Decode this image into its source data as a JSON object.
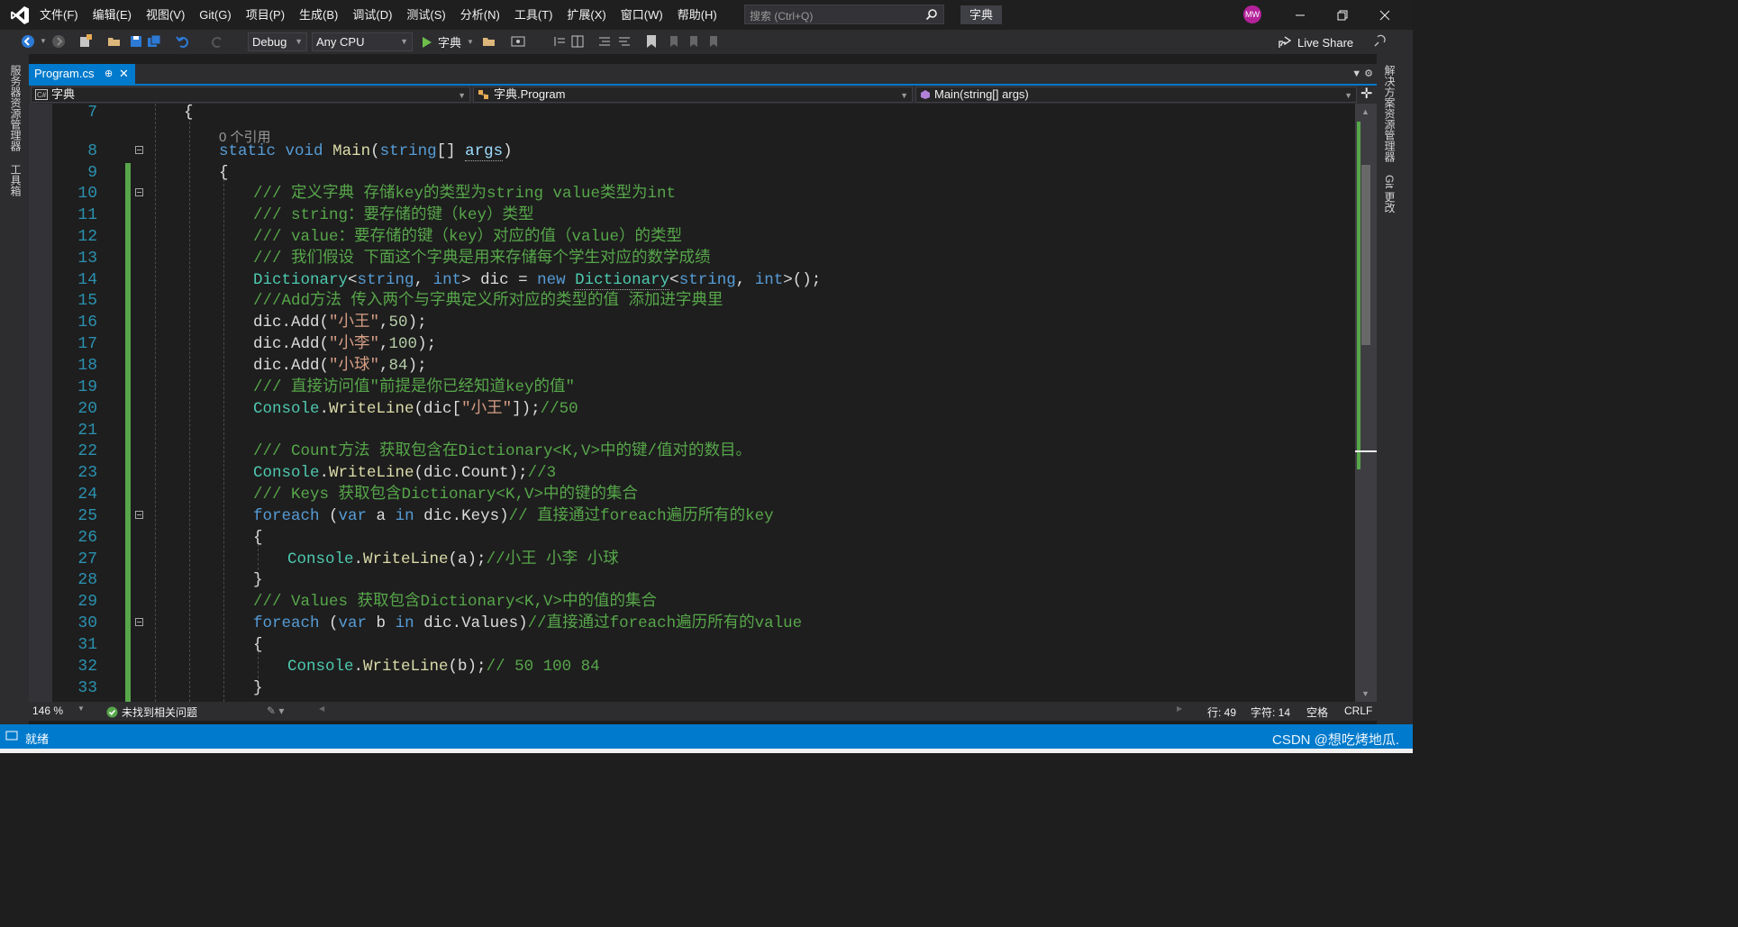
{
  "titlebar": {
    "logo_icon": "visual-studio-logo",
    "menu": [
      {
        "label": "文件(F)"
      },
      {
        "label": "编辑(E)"
      },
      {
        "label": "视图(V)"
      },
      {
        "label": "Git(G)"
      },
      {
        "label": "项目(P)"
      },
      {
        "label": "生成(B)"
      },
      {
        "label": "调试(D)"
      },
      {
        "label": "测试(S)"
      },
      {
        "label": "分析(N)"
      },
      {
        "label": "工具(T)"
      },
      {
        "label": "扩展(X)"
      },
      {
        "label": "窗口(W)"
      },
      {
        "label": "帮助(H)"
      }
    ],
    "search_placeholder": "搜索 (Ctrl+Q)",
    "solution_name": "字典",
    "avatar_initials": "MW"
  },
  "toolbar": {
    "config": "Debug",
    "platform": "Any CPU",
    "run_label": "字典",
    "live_share": "Live Share"
  },
  "rails": {
    "left": [
      "服务器资源管理器",
      "工具箱"
    ],
    "right": [
      "解决方案资源管理器",
      "Git 更改"
    ]
  },
  "tab": {
    "title": "Program.cs",
    "pin": "⊕",
    "close": "✕"
  },
  "nav": {
    "project": "字典",
    "class": "字典.Program",
    "member": "Main(string[] args)"
  },
  "editor": {
    "ref_count": "0 个引用",
    "line_numbers": [
      "7",
      "8",
      "9",
      "10",
      "11",
      "12",
      "13",
      "14",
      "15",
      "16",
      "17",
      "18",
      "19",
      "20",
      "21",
      "22",
      "23",
      "24",
      "25",
      "26",
      "27",
      "28",
      "29",
      "30",
      "31",
      "32",
      "33"
    ],
    "tokens": {
      "brace_open": "{",
      "brace_close": "}",
      "main_static": "static",
      "main_void": "void",
      "main_name": "Main",
      "main_paren_open": "(",
      "main_string": "string",
      "main_brackets": "[] ",
      "main_args": "args",
      "main_paren_close": ")",
      "c10": "/// 定义字典 存储key的类型为string value类型为int",
      "c11": "/// string：要存储的键（key）类型",
      "c12": "/// value：要存储的键（key）对应的值（value）的类型",
      "c13": "/// 我们假设 下面这个字典是用来存储每个学生对应的数学成绩",
      "l14_dict": "Dictionary",
      "l14_lt": "<",
      "l14_string": "string",
      "l14_comma": ", ",
      "l14_int": "int",
      "l14_gt_var": "> dic = ",
      "l14_new": "new",
      "l14_sp": " ",
      "l14_dict2": "Dictionary",
      "l14_lt2": "<",
      "l14_string2": "string",
      "l14_comma2": ", ",
      "l14_int2": "int",
      "l14_end": ">();",
      "c15": "///Add方法 传入两个与字典定义所对应的类型的值 添加进字典里",
      "dic_add": "dic.Add(",
      "s16": "\"小王\"",
      "n16": "50",
      "s17": "\"小李\"",
      "n17": "100",
      "s18": "\"小球\"",
      "n18": "84",
      "call_end": ");",
      "comma": ",",
      "c19": "/// 直接访问值\"前提是你已经知道key的值\"",
      "console": "Console",
      "dot": ".",
      "writeline": "WriteLine",
      "l20_open": "(dic[",
      "l20_close": "]);",
      "c20": "//50",
      "c22": "/// Count方法 获取包含在Dictionary<K,V>中的键/值对的数目。",
      "l23_args": "(dic.Count);",
      "c23": "//3",
      "c24": "/// Keys 获取包含Dictionary<K,V>中的键的集合",
      "foreach": "foreach",
      "paren_open": " (",
      "var": "var",
      "a_in": " a ",
      "in": "in",
      "keys_expr": " dic.Keys)",
      "c25": "// 直接通过foreach遍历所有的key",
      "l27_args": "(a);",
      "c27": "//小王 小李 小球",
      "c29": "/// Values 获取包含Dictionary<K,V>中的值的集合",
      "b_in": " b ",
      "values_expr": " dic.Values)",
      "c30": "//直接通过foreach遍历所有的value",
      "l32_args": "(b);",
      "c32": "// 50 100 84"
    }
  },
  "editor_status": {
    "zoom": "146 %",
    "issues": "未找到相关问题",
    "line": "行: 49",
    "char": "字符: 14",
    "space": "空格",
    "eol": "CRLF"
  },
  "status": {
    "ready": "就绪",
    "watermark": "CSDN @想吃烤地瓜."
  }
}
